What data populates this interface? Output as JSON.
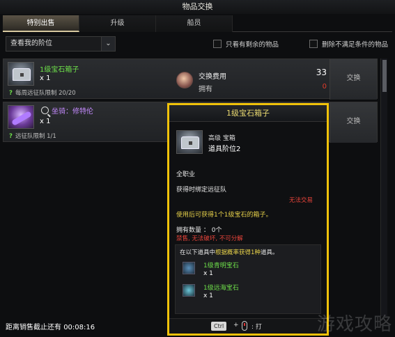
{
  "window": {
    "title": "物品交换"
  },
  "tabs": [
    {
      "label": "特别出售",
      "active": true
    },
    {
      "label": "升级",
      "active": false
    },
    {
      "label": "船员",
      "active": false
    }
  ],
  "filter": {
    "dropdown_value": "查看我的阶位",
    "checkbox1_label": "只看有剩余的物品",
    "checkbox2_label": "删除不满足条件的物品"
  },
  "items": [
    {
      "name": "1级宝石箱子",
      "quantity": "x 1",
      "limit_text": "每周远征队限制 20/20",
      "icon": "chest-icon"
    },
    {
      "name": "坐骑：修特伦",
      "quantity": "x 1",
      "limit_text": "远征队限制 1/1",
      "icon": "mount-icon"
    }
  ],
  "cost": {
    "label": "交换费用",
    "value": "33",
    "owned_label": "拥有",
    "owned_value": "0",
    "icon": "coin-icon"
  },
  "exchange_button_label": "交换",
  "timer": {
    "label": "距离销售截止还有",
    "value": "00:08:16"
  },
  "tooltip": {
    "title": "1级宝石箱子",
    "grade": "高级 宝箱",
    "tier": "道具阶位2",
    "class_req": "全职业",
    "bind": "获得时绑定远征队",
    "trade": "无法交易",
    "description": "使用后可获得1个1级宝石的箱子。",
    "owned": "拥有数量 ： 0个",
    "restrictions": "禁售, 无法破坏, 不可分解",
    "pool_prefix": "在以下道具中",
    "pool_highlight": "根据概率获得1种",
    "pool_suffix": "道具。",
    "rewards": [
      {
        "name": "1级青明宝石",
        "qty": "x 1"
      },
      {
        "name": "1级远海宝石",
        "qty": "x 1"
      }
    ],
    "key_hint": "Ctrl",
    "plus": "+",
    "action": ": 打"
  },
  "watermark": "游戏攻略",
  "colors": {
    "accent": "#f0c20a",
    "green": "#6ee04a",
    "red": "#e23a2a",
    "purple": "#c58bff"
  }
}
